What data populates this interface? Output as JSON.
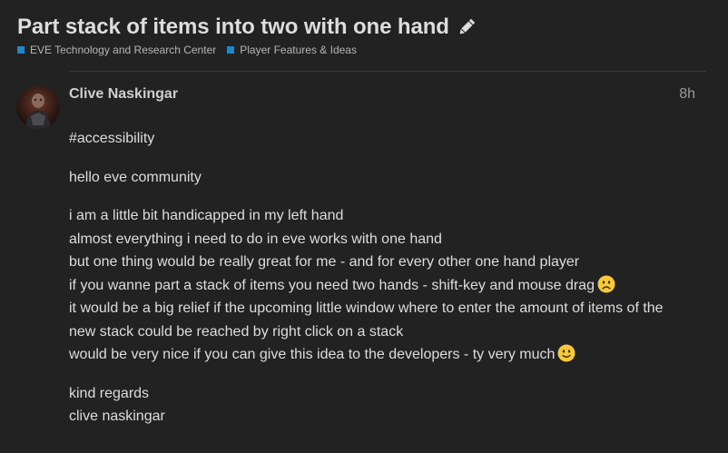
{
  "topic": {
    "title": "Part stack of items into two with one hand",
    "edit_icon": "pencil-icon"
  },
  "categories": [
    {
      "label": "EVE Technology and Research Center",
      "color": "#1e88c7"
    },
    {
      "label": "Player Features & Ideas",
      "color": "#1e88c7"
    }
  ],
  "post": {
    "author": "Clive Naskingar",
    "date": "8h",
    "paragraphs": [
      {
        "lines": [
          "#accessibility"
        ]
      },
      {
        "lines": [
          "hello eve community"
        ]
      },
      {
        "lines": [
          "i am a little bit handicapped in my left hand",
          "almost everything i need to do in eve works with one hand",
          "but one thing would be really great for me - and for every other one hand player",
          "if you wanne part a stack of items you need two hands - shift-key and mouse drag",
          "it would be a big relief if the upcoming little window where to enter the amount of items of the",
          "new stack could be reached by right click on a stack",
          "would be very nice if you can give this idea to the developers - ty very much"
        ]
      },
      {
        "lines": [
          "kind regards",
          "clive naskingar"
        ]
      }
    ],
    "emojis": {
      "sad": "frowning-face-icon",
      "happy": "slightly-smiling-face-icon"
    }
  }
}
